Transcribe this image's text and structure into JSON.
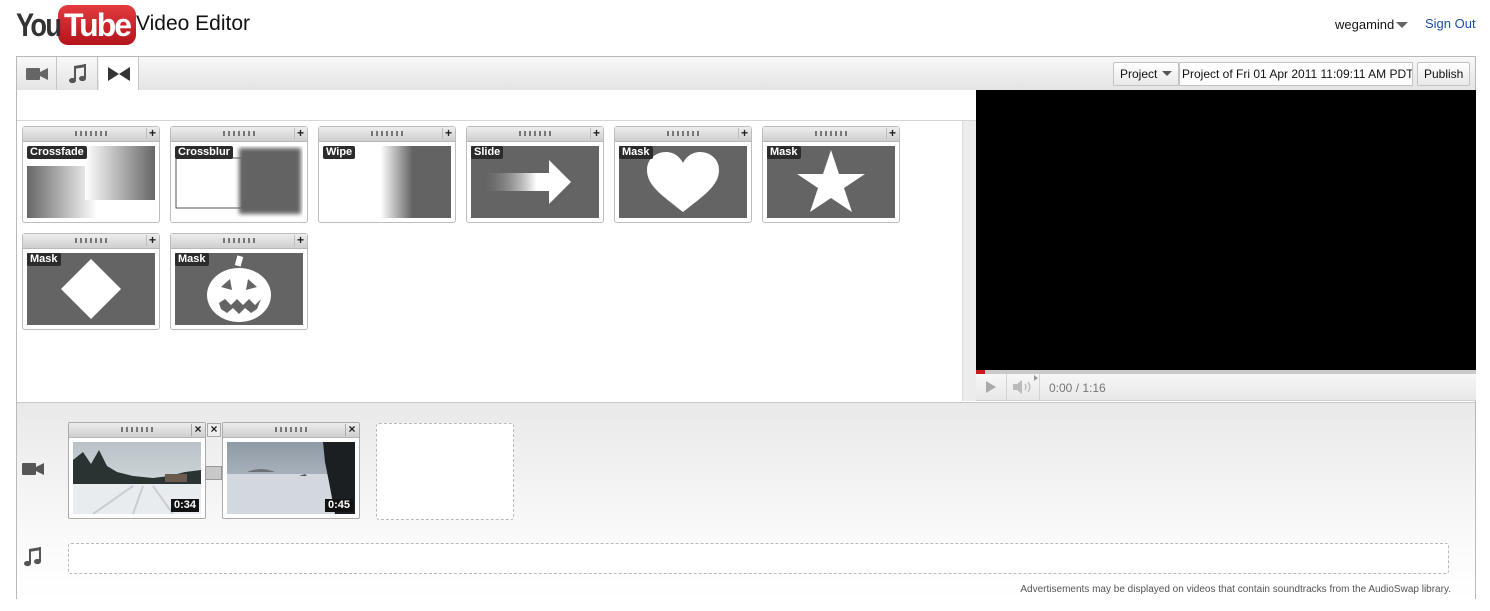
{
  "header": {
    "logo": {
      "you": "You",
      "tube": "Tube"
    },
    "app_title": "Video Editor",
    "user": "wegamind",
    "sign_out": "Sign Out",
    "logo_red": "#d7262b",
    "link_color": "#1c4fa5"
  },
  "toolbar": {
    "tabs": [
      {
        "icon": "video-camera-icon",
        "active": false
      },
      {
        "icon": "music-note-icon",
        "active": false
      },
      {
        "icon": "transition-icon",
        "active": true
      }
    ],
    "project_menu": "Project",
    "project_name": "Project of Fri 01 Apr 2011 11:09:11 AM PDT",
    "publish": "Publish"
  },
  "library": {
    "transitions": [
      {
        "label": "Crossfade",
        "shape": "crossfade"
      },
      {
        "label": "Crossblur",
        "shape": "crossblur"
      },
      {
        "label": "Wipe",
        "shape": "wipe"
      },
      {
        "label": "Slide",
        "shape": "arrow"
      },
      {
        "label": "Mask",
        "shape": "heart"
      },
      {
        "label": "Mask",
        "shape": "star"
      },
      {
        "label": "Mask",
        "shape": "diamond"
      },
      {
        "label": "Mask",
        "shape": "pumpkin"
      }
    ]
  },
  "player": {
    "time": "0:00 / 1:16",
    "progress": 0.018,
    "progress_color": "#c81a1a"
  },
  "timeline": {
    "clips": [
      {
        "duration": "0:34"
      },
      {
        "duration": "0:45"
      }
    ],
    "disclaimer": "Advertisements may be displayed on videos that contain soundtracks from the AudioSwap library."
  }
}
